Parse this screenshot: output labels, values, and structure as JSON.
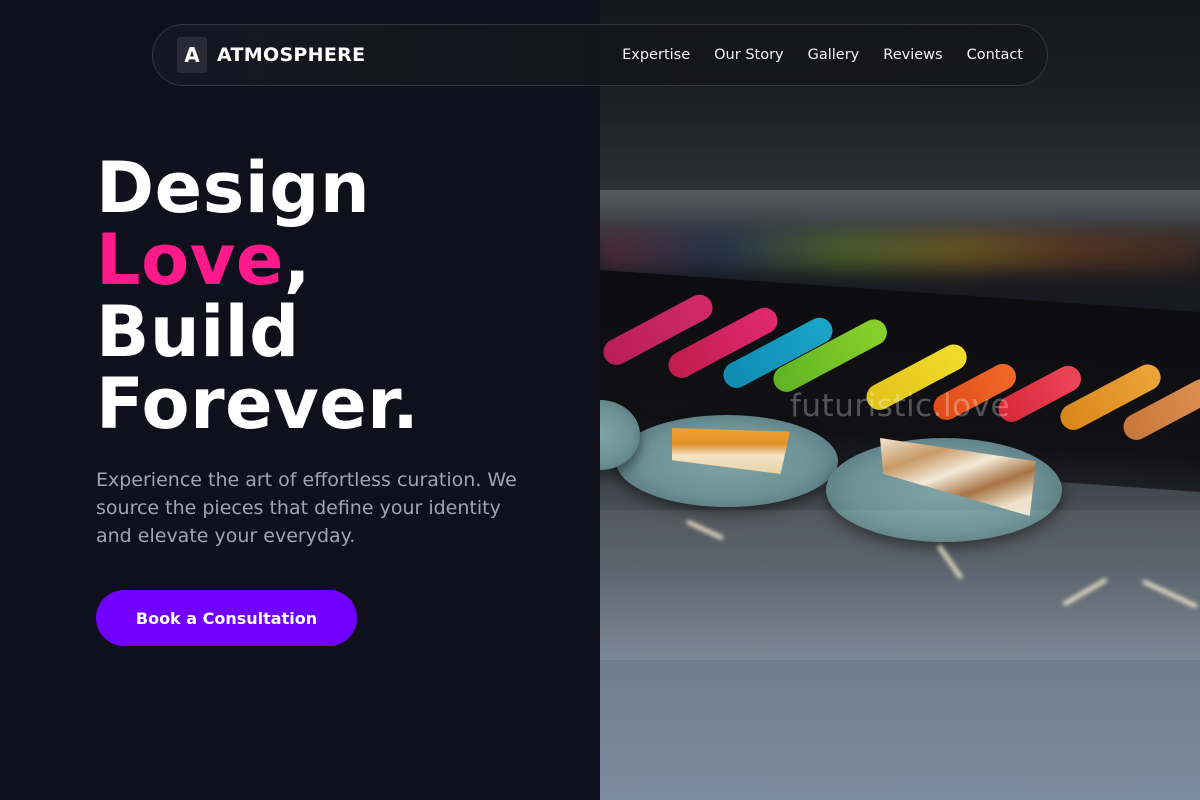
{
  "brand": {
    "mark": "A",
    "name": "ATMOSPHERE"
  },
  "nav": {
    "links": [
      "Expertise",
      "Our Story",
      "Gallery",
      "Reviews",
      "Contact"
    ]
  },
  "hero": {
    "headline_line1": "Design",
    "headline_accent": "Love",
    "headline_comma": ",",
    "headline_line3": "Build",
    "headline_line4": "Forever.",
    "subtext": "Experience the art of effortless curation. We source the pieces that define your identity and elevate your everyday.",
    "cta_label": "Book a Consultation"
  },
  "image": {
    "watermark": "futuristic.love",
    "description_icon": "pastry-display-photo"
  },
  "colors": {
    "background": "#10101c",
    "accent_pink": "#ff1a8c",
    "cta_purple": "#7000ff",
    "subtext_gray": "#a2a3b3"
  }
}
